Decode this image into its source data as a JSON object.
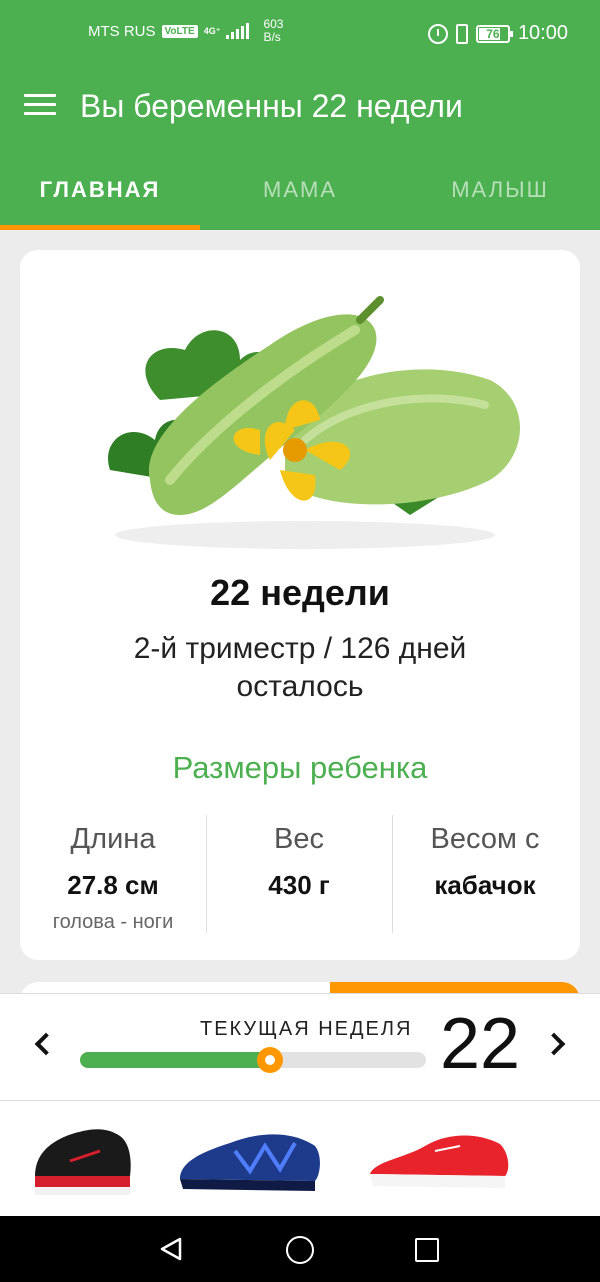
{
  "status_bar": {
    "carrier": "MTS RUS",
    "volte": "VoLTE",
    "network": "4G⁺",
    "speed_value": "603",
    "speed_unit": "B/s",
    "battery_percent": 76,
    "battery_text": "76",
    "time": "10:00"
  },
  "app_bar": {
    "title": "Вы беременны 22 недели"
  },
  "tabs": [
    {
      "label": "ГЛАВНАЯ",
      "active": true
    },
    {
      "label": "МАМА",
      "active": false
    },
    {
      "label": "МАЛЫШ",
      "active": false
    }
  ],
  "card": {
    "image": "zucchini-illustration",
    "week_title": "22 недели",
    "trimester_text": "2-й триместр / 126 дней осталось",
    "sizes_title": "Размеры ребенка",
    "stats": [
      {
        "label": "Длина",
        "value": "27.8 см",
        "note": "голова - ноги"
      },
      {
        "label": "Вес",
        "value": "430 г",
        "note": ""
      },
      {
        "label": "Весом с",
        "value": "кабачок",
        "note": ""
      }
    ]
  },
  "week_panel": {
    "label": "ТЕКУЩАЯ НЕДЕЛЯ",
    "current_week": "22",
    "progress_fraction": 0.55
  },
  "ad": {
    "items": [
      "black-red-sneaker",
      "blue-sneaker",
      "red-sneaker"
    ]
  },
  "colors": {
    "primary": "#4caf50",
    "accent": "#ff9800"
  }
}
